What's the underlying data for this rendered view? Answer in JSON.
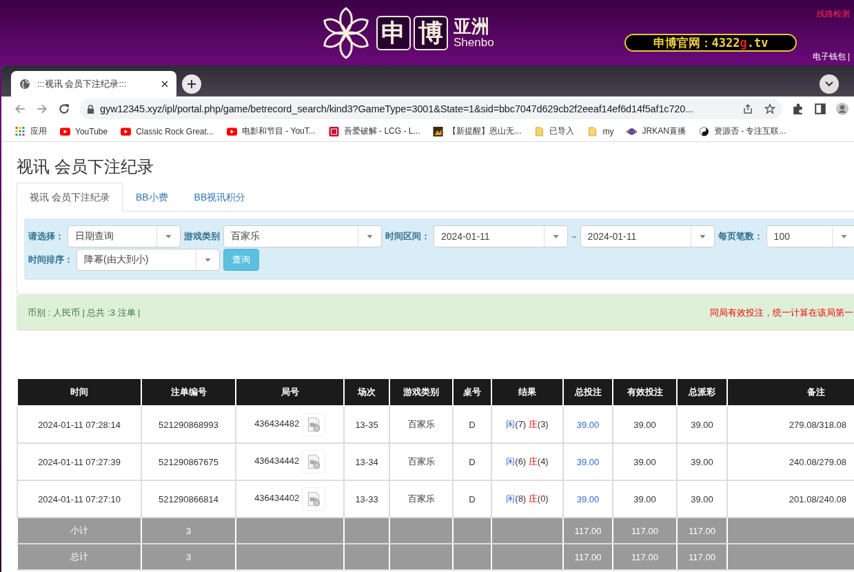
{
  "site_header": {
    "logo_chars": [
      "申",
      "博"
    ],
    "logo_region": "亚洲",
    "logo_latin": "Shenbo",
    "banner_prefix": "申博官网：4322",
    "banner_highlight": "g",
    "banner_suffix": ".tv",
    "line_check": "线路检测",
    "wallet": "电子钱包 |"
  },
  "browser": {
    "tabs": [
      {
        "title": ":::视讯 会员下注纪录:::",
        "selected": true
      }
    ],
    "address": "gyw12345.xyz/ipl/portal.php/game/betrecord_search/kind3?GameType=3001&State=1&sid=bbc7047d629cb2f2eeaf14ef6d14f5af1c720...",
    "bookmarks": [
      {
        "label": "应用",
        "kind": "apps"
      },
      {
        "label": "YouTube",
        "kind": "video"
      },
      {
        "label": "Classic Rock Great...",
        "kind": "video"
      },
      {
        "label": "电影和节目 - YouT...",
        "kind": "video"
      },
      {
        "label": "吾爱破解 - LCG - L...",
        "kind": "badge"
      },
      {
        "label": "【新提醒】恩山无...",
        "kind": "image"
      },
      {
        "label": "已导入",
        "kind": "folder"
      },
      {
        "label": "my",
        "kind": "folder"
      },
      {
        "label": "JRKAN直播",
        "kind": "planet"
      },
      {
        "label": "资源否 - 专注互联...",
        "kind": "yinyang"
      }
    ]
  },
  "page": {
    "title": "视讯 会员下注纪录",
    "tabs": [
      {
        "label": "视讯 会员下注纪录",
        "selected": true
      },
      {
        "label": "BB小费",
        "selected": false
      },
      {
        "label": "BB视讯积分",
        "selected": false
      }
    ],
    "filter_rows": [
      [
        {
          "kind": "select",
          "label": "请选择：",
          "value": "日期查询"
        },
        {
          "kind": "select",
          "label": "游戏类别",
          "value": "百家乐"
        },
        {
          "kind": "select",
          "label": "时间区间：",
          "value": "2024-01-11"
        },
        {
          "kind": "separator",
          "text": "~"
        },
        {
          "kind": "select",
          "value": "2024-01-11"
        },
        {
          "kind": "select",
          "label": "每页笔数：",
          "value": "100"
        }
      ],
      [
        {
          "kind": "select",
          "label": "时间排序：",
          "value": "降幂(由大到小)"
        },
        {
          "kind": "button",
          "label": "查询"
        }
      ]
    ],
    "summary": "币别 : 人民币 | 总共 :3 注单 |",
    "notice": "同局有效投注，统一计算在该局第一",
    "table": {
      "columns": [
        "时间",
        "注单编号",
        "局号",
        "场次",
        "游戏类别",
        "桌号",
        "结果",
        "总投注",
        "有效投注",
        "总派彩",
        "备注"
      ],
      "rows": [
        {
          "time": "2024-01-11 07:28:14",
          "bet_id": "521290868993",
          "round_id": "436434482",
          "session": "13-35",
          "game": "百家乐",
          "table_no": "D",
          "player": "闲",
          "player_points": "(7)",
          "banker": "庄",
          "banker_points": "(3)",
          "total_bet": "39.00",
          "valid_bet": "39.00",
          "payout": "39.00",
          "note": "279.08/318.08"
        },
        {
          "time": "2024-01-11 07:27:39",
          "bet_id": "521290867675",
          "round_id": "436434442",
          "session": "13-34",
          "game": "百家乐",
          "table_no": "D",
          "player": "闲",
          "player_points": "(6)",
          "banker": "庄",
          "banker_points": "(4)",
          "total_bet": "39.00",
          "valid_bet": "39.00",
          "payout": "39.00",
          "note": "240.08/279.08"
        },
        {
          "time": "2024-01-11 07:27:10",
          "bet_id": "521290866814",
          "round_id": "436434402",
          "session": "13-33",
          "game": "百家乐",
          "table_no": "D",
          "player": "闲",
          "player_points": "(8)",
          "banker": "庄",
          "banker_points": "(0)",
          "total_bet": "39.00",
          "valid_bet": "39.00",
          "payout": "39.00",
          "note": "201.08/240.08"
        }
      ],
      "totals": [
        {
          "label": "小计",
          "count": "3",
          "total_bet": "117.00",
          "valid_bet": "117.00",
          "payout": "117.00"
        },
        {
          "label": "总计",
          "count": "3",
          "total_bet": "117.00",
          "valid_bet": "117.00",
          "payout": "117.00"
        }
      ]
    }
  }
}
